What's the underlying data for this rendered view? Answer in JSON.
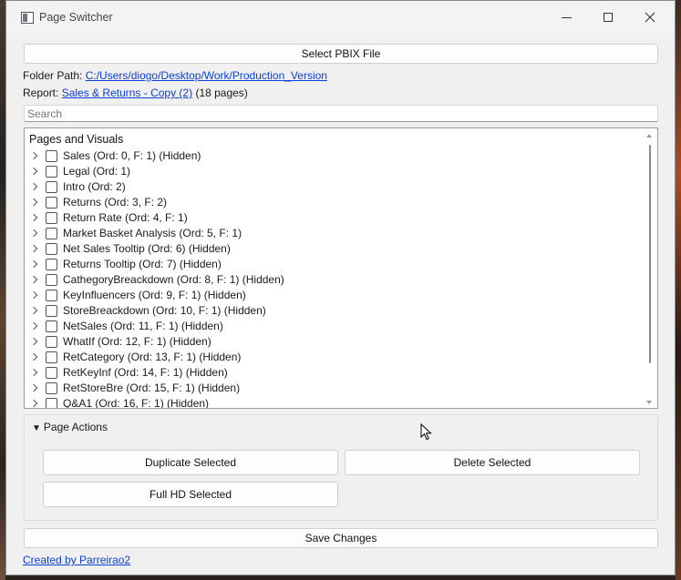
{
  "window": {
    "title": "Page Switcher"
  },
  "toolbar": {
    "select_file_label": "Select PBIX File"
  },
  "folder": {
    "label": "Folder Path:",
    "path": "C:/Users/diogo/Desktop/Work/Production_Version"
  },
  "report": {
    "label": "Report:",
    "name": "Sales & Returns - Copy (2)",
    "count": "(18 pages)"
  },
  "search": {
    "placeholder": "Search"
  },
  "tree": {
    "header": "Pages and Visuals",
    "items": [
      "Sales (Ord: 0, F: 1) (Hidden)",
      "Legal (Ord: 1)",
      "Intro (Ord: 2)",
      "Returns (Ord: 3, F: 2)",
      "Return Rate (Ord: 4, F: 1)",
      "Market Basket Analysis (Ord: 5, F: 1)",
      "Net Sales Tooltip (Ord: 6) (Hidden)",
      "Returns Tooltip (Ord: 7) (Hidden)",
      "CathegoryBreackdown (Ord: 8, F: 1) (Hidden)",
      "KeyInfluencers (Ord: 9, F: 1) (Hidden)",
      "StoreBreackdown (Ord: 10, F: 1) (Hidden)",
      "NetSales (Ord: 11, F: 1) (Hidden)",
      "WhatIf (Ord: 12, F: 1) (Hidden)",
      "RetCategory (Ord: 13, F: 1) (Hidden)",
      "RetKeyInf (Ord: 14, F: 1) (Hidden)",
      "RetStoreBre (Ord: 15, F: 1) (Hidden)",
      "Q&A1 (Ord: 16, F: 1) (Hidden)"
    ]
  },
  "actions": {
    "title": "Page Actions",
    "duplicate_label": "Duplicate Selected",
    "delete_label": "Delete Selected",
    "fullhd_label": "Full HD Selected"
  },
  "save_label": "Save Changes",
  "footer": {
    "credit": "Created by Parreirao2"
  },
  "colors": {
    "link": "#0b3fd6",
    "window_bg": "#f0f0f0"
  }
}
